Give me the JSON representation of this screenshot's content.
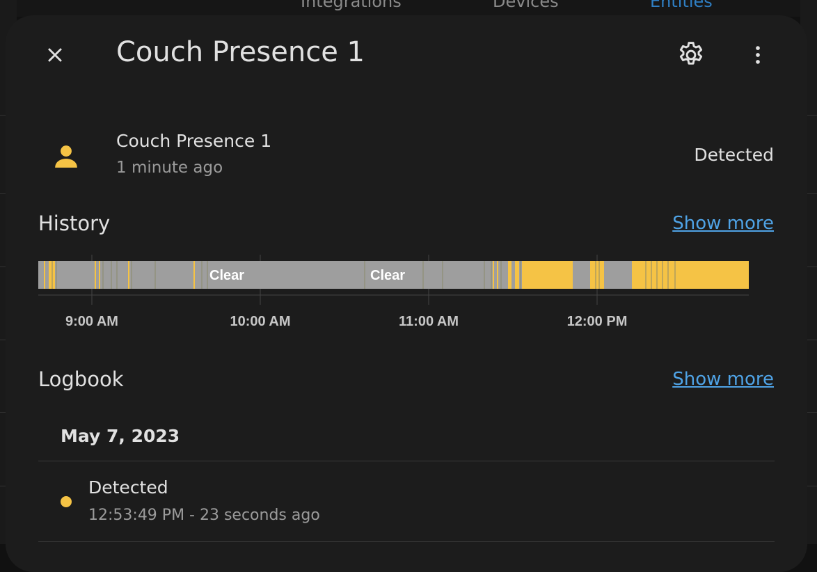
{
  "background": {
    "tabs": [
      {
        "label": "Integrations",
        "active": false
      },
      {
        "label": "Devices",
        "active": false
      },
      {
        "label": "Entities",
        "active": true
      }
    ]
  },
  "dialog": {
    "title": "Couch Presence 1",
    "close_icon": "close-icon",
    "settings_icon": "gear-icon",
    "more_icon": "more-vert-icon"
  },
  "entity": {
    "icon": "account-icon",
    "name": "Couch Presence 1",
    "last_changed": "1 minute ago",
    "state": "Detected"
  },
  "history": {
    "title": "History",
    "show_more": "Show more",
    "colors": {
      "detected": "#f5c345",
      "clear": "#9e9e9e",
      "grid": "#444444"
    },
    "bar_labels": [
      "Clear",
      "Clear"
    ],
    "ticks": [
      "9:00 AM",
      "10:00 AM",
      "11:00 AM",
      "12:00 PM"
    ]
  },
  "logbook": {
    "title": "Logbook",
    "show_more": "Show more",
    "date": "May 7, 2023",
    "entries": [
      {
        "message": "Detected",
        "time": "12:53:49 PM - 23 seconds ago",
        "color": "#f5c345"
      }
    ]
  }
}
